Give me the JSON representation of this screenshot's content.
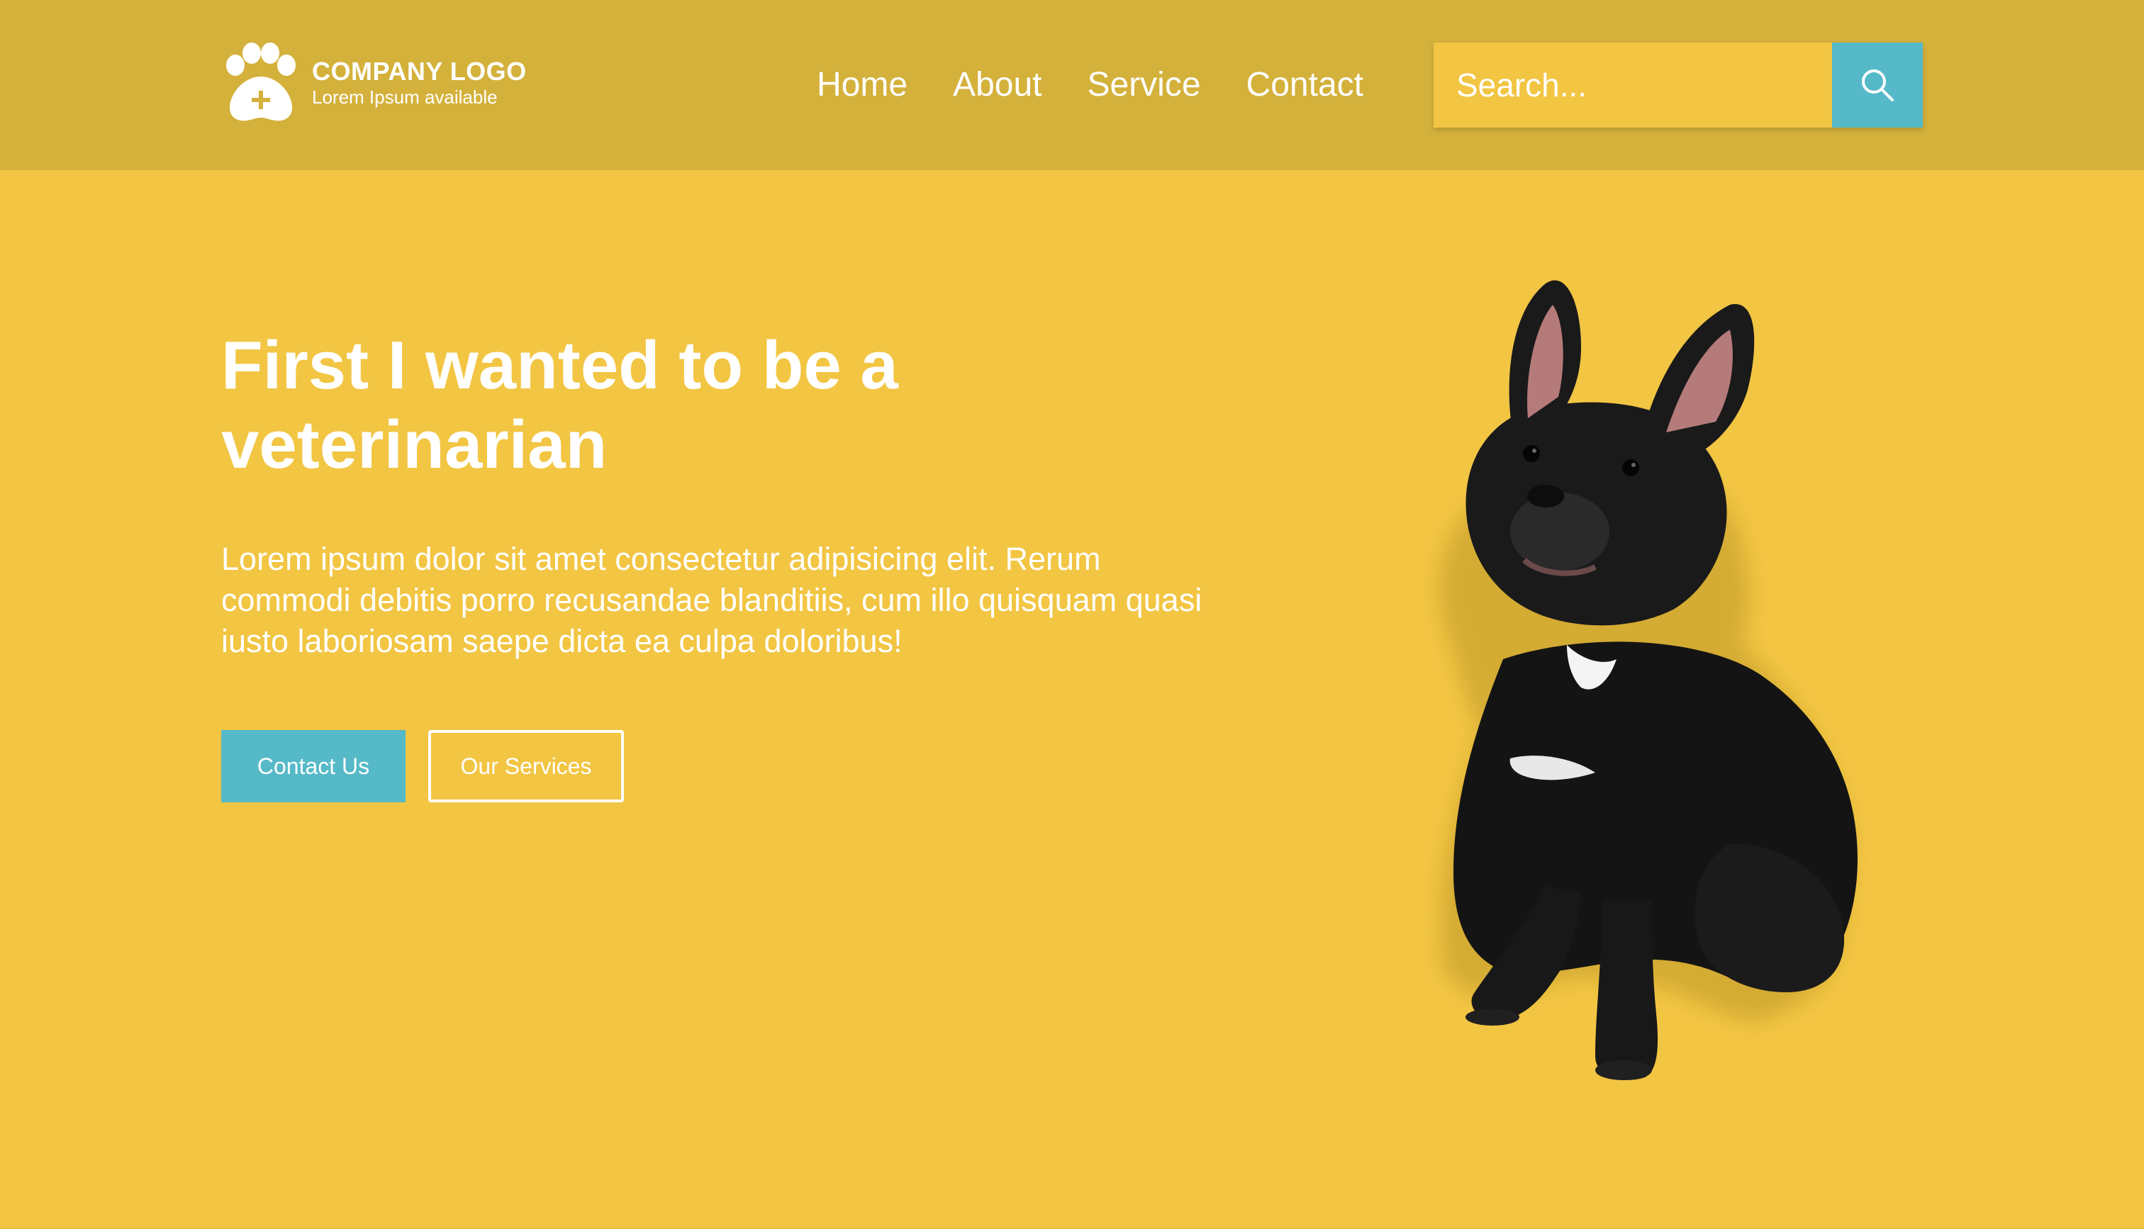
{
  "header": {
    "logo": {
      "title": "COMPANY LOGO",
      "subtitle": "Lorem Ipsum available",
      "icon": "paw-plus-icon"
    },
    "nav": [
      {
        "label": "Home"
      },
      {
        "label": "About"
      },
      {
        "label": "Service"
      },
      {
        "label": "Contact"
      }
    ],
    "search": {
      "placeholder": "Search...",
      "value": "",
      "button_icon": "search-icon"
    }
  },
  "hero": {
    "title": "First I wanted to be a veterinarian",
    "text": "Lorem ipsum dolor sit amet consectetur adipisicing elit. Rerum commodi debitis porro recusandae blanditiis, cum illo quisquam quasi iusto laboriosam saepe dicta ea culpa doloribus!",
    "primary_button": "Contact Us",
    "secondary_button": "Our Services",
    "image": "french-bulldog-photo"
  },
  "colors": {
    "background": "#f2c543",
    "header": "#d4b13b",
    "accent": "#56b9c8",
    "text": "#ffffff"
  }
}
